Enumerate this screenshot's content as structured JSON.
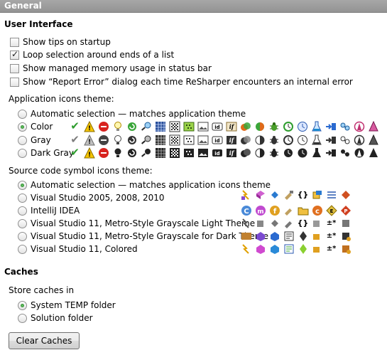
{
  "header": {
    "title": "General"
  },
  "ui": {
    "title": "User Interface",
    "checkboxes": [
      {
        "label": "Show tips on startup",
        "checked": false
      },
      {
        "label": "Loop selection around ends of a list",
        "checked": true
      },
      {
        "label": "Show managed memory usage in status bar",
        "checked": false
      },
      {
        "label": "Show “Report Error” dialog each time ReSharper encounters an internal error",
        "checked": false
      }
    ],
    "app_icons_label": "Application icons theme:",
    "app_themes": [
      {
        "label": "Automatic selection — matches application theme",
        "selected": false
      },
      {
        "label": "Color",
        "selected": true
      },
      {
        "label": "Gray",
        "selected": false
      },
      {
        "label": "Dark Gray",
        "selected": false
      }
    ],
    "source_icons_label": "Source code symbol icons theme:",
    "source_themes": [
      {
        "label": "Automatic selection — matches application icons theme",
        "selected": true
      },
      {
        "label": "Visual Studio 2005, 2008, 2010",
        "selected": false
      },
      {
        "label": "IntelliJ IDEA",
        "selected": false
      },
      {
        "label": "Visual Studio 11, Metro-Style Grayscale Light Theme",
        "selected": false
      },
      {
        "label": "Visual Studio 11, Metro-Style Grayscale for Dark Theme",
        "selected": false
      },
      {
        "label": "Visual Studio 11, Colored",
        "selected": false
      }
    ]
  },
  "caches": {
    "title": "Caches",
    "store_label": "Store caches in",
    "locations": [
      {
        "label": "System TEMP folder",
        "selected": true
      },
      {
        "label": "Solution folder",
        "selected": false
      }
    ],
    "clear_button": "Clear Caches"
  },
  "colors": {
    "header_bg": "#9d9d9d",
    "check_green": "#2e9d2e",
    "warning_yellow": "#f5c400",
    "error_red": "#d8231f"
  }
}
